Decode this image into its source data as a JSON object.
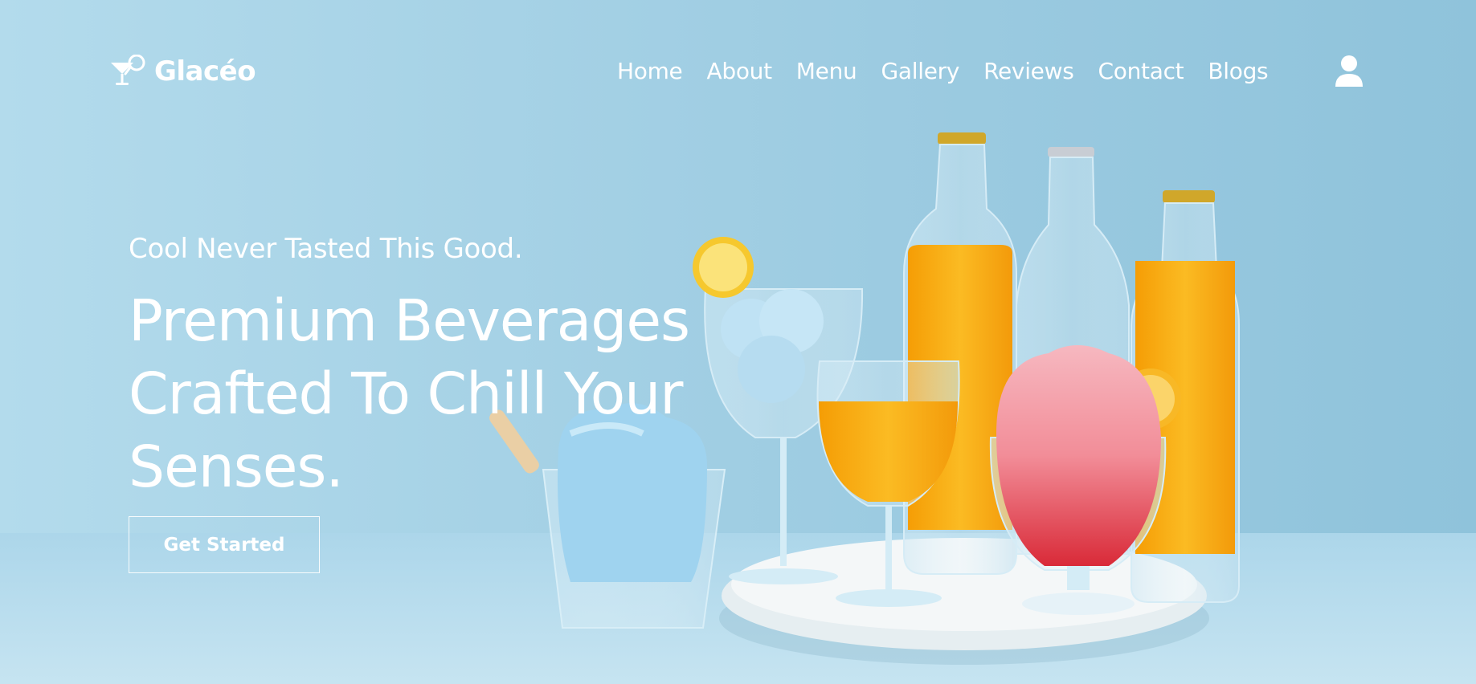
{
  "brand": {
    "name": "Glacéo",
    "icon": "cocktail-glass-icon"
  },
  "nav": {
    "items": [
      {
        "label": "Home"
      },
      {
        "label": "About"
      },
      {
        "label": "Menu"
      },
      {
        "label": "Gallery"
      },
      {
        "label": "Reviews"
      },
      {
        "label": "Contact"
      },
      {
        "label": "Blogs"
      }
    ],
    "user_icon": "user-icon"
  },
  "hero": {
    "tagline": "Cool Never Tasted This Good.",
    "headline": "Premium Beverages Crafted To Chill Your Senses.",
    "cta_label": "Get Started"
  },
  "colors": {
    "background": "#a9d3e6",
    "text": "#ffffff",
    "orange_juice": "#f7a90c",
    "blue_slush": "#a9d8f2",
    "pink_slush": "#f3a7b2",
    "red_syrup": "#e63a45"
  }
}
